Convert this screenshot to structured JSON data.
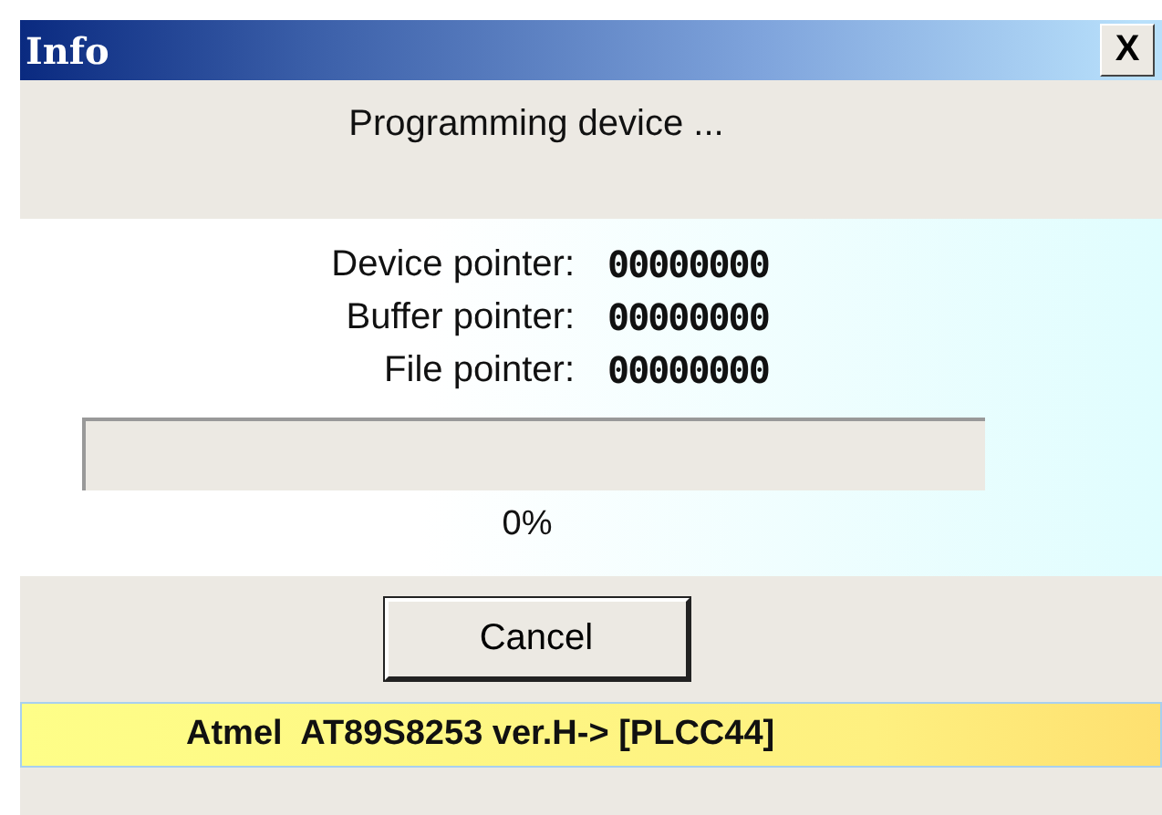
{
  "window": {
    "title": "Info",
    "close": "X"
  },
  "message": "Programming device ...",
  "pointers": [
    {
      "label": "Device pointer:",
      "value": "00000000"
    },
    {
      "label": "Buffer pointer:",
      "value": "00000000"
    },
    {
      "label": "File pointer:",
      "value": "00000000"
    }
  ],
  "progress": {
    "level": 0,
    "reading": "0%"
  },
  "buttons": [
    "Cancel"
  ],
  "status_bar": "Atmel  AT89S8253 ver.H-> [PLCC44]"
}
